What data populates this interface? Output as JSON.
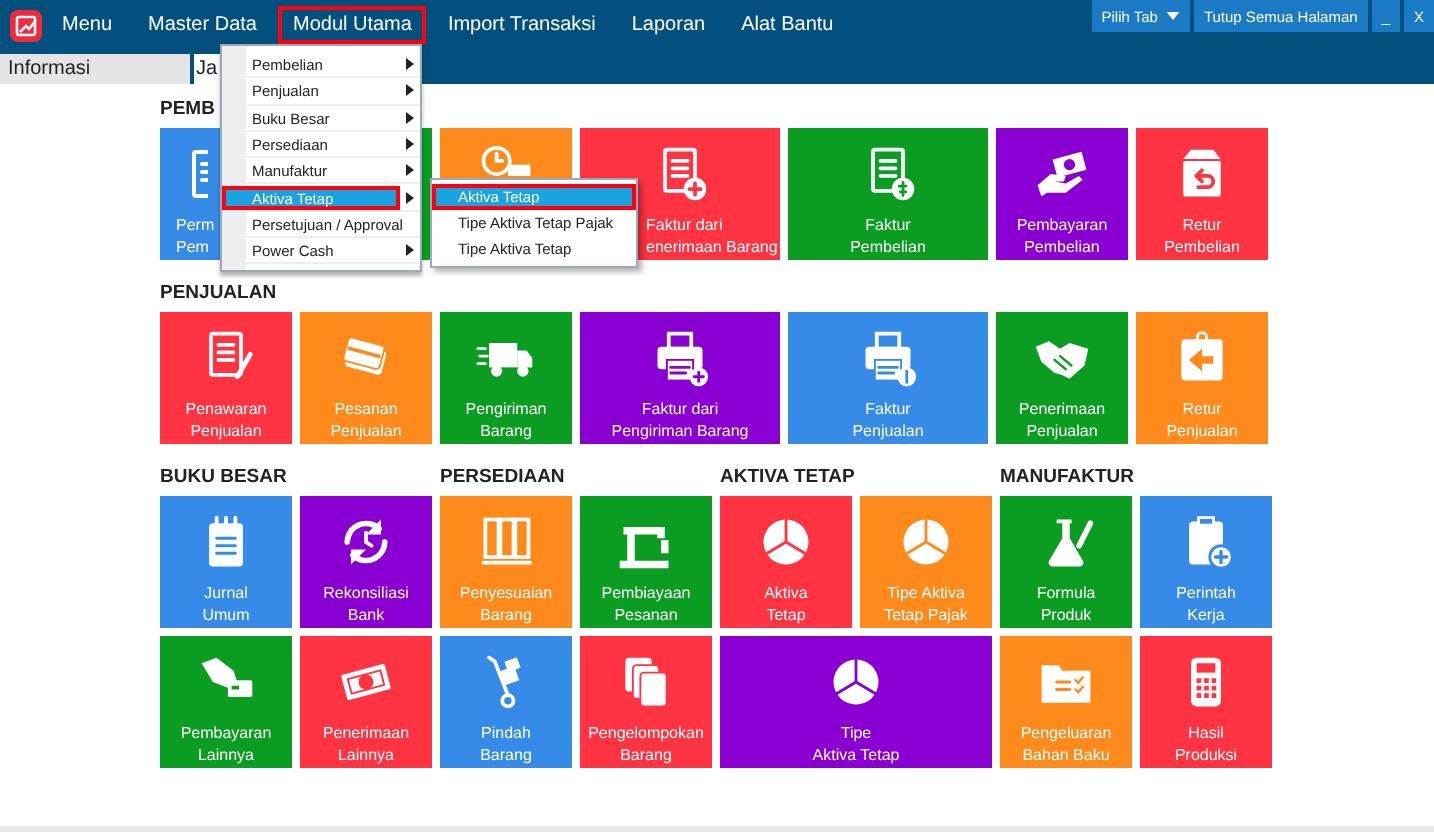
{
  "app_menu": {
    "label": "Menu"
  },
  "menubar": [
    {
      "label": "Master Data",
      "marked": false
    },
    {
      "label": "Modul Utama",
      "marked": true
    },
    {
      "label": "Import Transaksi",
      "marked": false
    },
    {
      "label": "Laporan",
      "marked": false
    },
    {
      "label": "Alat Bantu",
      "marked": false
    }
  ],
  "window_buttons": [
    {
      "label": "Pilih Tab",
      "kind": "dropdown"
    },
    {
      "label": "Tutup Semua Halaman",
      "kind": "plain"
    },
    {
      "label": "_",
      "kind": "plain"
    },
    {
      "label": "X",
      "kind": "plain"
    }
  ],
  "tabs": [
    {
      "label": "Informasi",
      "selected": false
    },
    {
      "label": "Ja",
      "selected": true
    }
  ],
  "dropdown": {
    "items": [
      {
        "label": "Pembelian",
        "submenu": true,
        "selected": false,
        "marked": false
      },
      {
        "label": "Penjualan",
        "submenu": true,
        "selected": false,
        "marked": false
      },
      {
        "label": "Buku Besar",
        "submenu": true,
        "selected": false,
        "marked": false
      },
      {
        "label": "Persediaan",
        "submenu": true,
        "selected": false,
        "marked": false
      },
      {
        "label": "Manufaktur",
        "submenu": true,
        "selected": false,
        "marked": false
      },
      {
        "label": "Aktiva Tetap",
        "submenu": true,
        "selected": true,
        "marked": true
      },
      {
        "label": "Persetujuan / Approval",
        "submenu": false,
        "selected": false,
        "marked": false
      },
      {
        "label": "Power Cash",
        "submenu": true,
        "selected": false,
        "marked": false
      }
    ],
    "submenu": {
      "items": [
        {
          "label": "Aktiva Tetap",
          "selected": true,
          "marked": true
        },
        {
          "label": "Tipe Aktiva Tetap Pajak",
          "selected": false,
          "marked": false
        },
        {
          "label": "Tipe Aktiva Tetap",
          "selected": false,
          "marked": false
        }
      ]
    }
  },
  "sections": [
    {
      "title": "PEMB",
      "tiles": [
        {
          "lines": [
            "Perm",
            "Pem"
          ],
          "color": "#368be8",
          "kind": "normal"
        },
        {
          "color": "#0a9d22",
          "kind": "normal"
        },
        {
          "color": "#ff8a1c",
          "kind": "normal"
        },
        {
          "lines": [
            "Faktur dari",
            "enerimaan Barang"
          ],
          "color": "#ff3342",
          "kind": "wide"
        },
        {
          "lines": [
            "Faktur",
            "Pembelian"
          ],
          "color": "#0a9d22",
          "kind": "wide"
        },
        {
          "lines": [
            "Pembayaran",
            "Pembelian"
          ],
          "color": "#8a00d2",
          "kind": "normal"
        },
        {
          "lines": [
            "Retur",
            "Pembelian"
          ],
          "color": "#ff3342",
          "kind": "normal"
        }
      ]
    },
    {
      "title": "PENJUALAN",
      "tiles": [
        {
          "lines": [
            "Penawaran",
            "Penjualan"
          ],
          "color": "#ff3342",
          "kind": "normal"
        },
        {
          "lines": [
            "Pesanan",
            "Penjualan"
          ],
          "color": "#ff8a1c",
          "kind": "normal"
        },
        {
          "lines": [
            "Pengiriman",
            "Barang"
          ],
          "color": "#0a9d22",
          "kind": "normal"
        },
        {
          "lines": [
            "Faktur dari",
            "Pengiriman Barang"
          ],
          "color": "#8a00d2",
          "kind": "wide"
        },
        {
          "lines": [
            "Faktur",
            "Penjualan"
          ],
          "color": "#368be8",
          "kind": "wide"
        },
        {
          "lines": [
            "Penerimaan",
            "Penjualan"
          ],
          "color": "#0a9d22",
          "kind": "normal"
        },
        {
          "lines": [
            "Retur",
            "Penjualan"
          ],
          "color": "#ff8a1c",
          "kind": "normal"
        }
      ]
    }
  ],
  "groups": [
    {
      "title": "BUKU BESAR",
      "tiles": [
        {
          "lines": [
            "Jurnal",
            "Umum"
          ],
          "color": "#368be8",
          "kind": "normal"
        },
        {
          "lines": [
            "Rekonsiliasi",
            "Bank"
          ],
          "color": "#8a00d2",
          "kind": "normal"
        },
        {
          "lines": [
            "Pembayaran",
            "Lainnya"
          ],
          "color": "#0a9d22",
          "kind": "normal"
        },
        {
          "lines": [
            "Penerimaan",
            "Lainnya"
          ],
          "color": "#ff3342",
          "kind": "normal"
        }
      ]
    },
    {
      "title": "PERSEDIAAN",
      "tiles": [
        {
          "lines": [
            "Penyesuaian",
            "Barang"
          ],
          "color": "#ff8a1c",
          "kind": "normal"
        },
        {
          "lines": [
            "Pembiayaan",
            "Pesanan"
          ],
          "color": "#0a9d22",
          "kind": "normal"
        },
        {
          "lines": [
            "Pindah",
            "Barang"
          ],
          "color": "#368be8",
          "kind": "normal"
        },
        {
          "lines": [
            "Pengelompokan",
            "Barang"
          ],
          "color": "#ff3342",
          "kind": "normal"
        }
      ]
    },
    {
      "title": "AKTIVA TETAP",
      "tiles": [
        {
          "lines": [
            "Aktiva",
            "Tetap"
          ],
          "color": "#ff3342",
          "kind": "normal"
        },
        {
          "lines": [
            "Tipe Aktiva",
            "Tetap Pajak"
          ],
          "color": "#ff8a1c",
          "kind": "normal"
        },
        {
          "lines": [
            "Tipe",
            "Aktiva Tetap"
          ],
          "color": "#8a00d2",
          "kind": "double"
        }
      ]
    },
    {
      "title": "MANUFAKTUR",
      "tiles": [
        {
          "lines": [
            "Formula",
            "Produk"
          ],
          "color": "#0a9d22",
          "kind": "normal"
        },
        {
          "lines": [
            "Perintah",
            "Kerja"
          ],
          "color": "#368be8",
          "kind": "normal"
        },
        {
          "lines": [
            "Pengeluaran",
            "Bahan Baku"
          ],
          "color": "#ff8a1c",
          "kind": "normal"
        },
        {
          "lines": [
            "Hasil",
            "Produksi"
          ],
          "color": "#ff3342",
          "kind": "normal"
        }
      ]
    }
  ]
}
